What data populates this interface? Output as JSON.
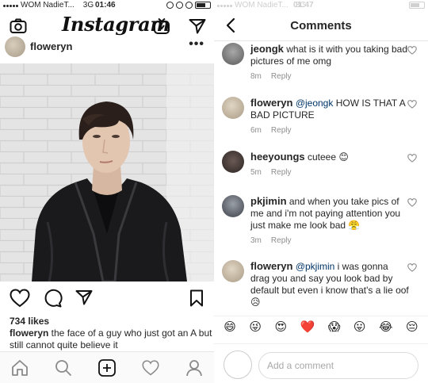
{
  "left_status": {
    "carrier": "WOM NadieT...",
    "network": "3G",
    "time": "01:46"
  },
  "right_status": {
    "carrier": "WOM NadieT...",
    "network": "3G",
    "time": "01:47"
  },
  "feed": {
    "logo": "Instagram",
    "post": {
      "username": "floweryn",
      "more": "•••",
      "watermark": "",
      "likes": "734 likes",
      "caption_user": "floweryn",
      "caption_text": " the face of a guy who just got an A but still cannot quite believe it"
    },
    "icons": {
      "camera": "camera-icon",
      "igtv": "igtv-icon",
      "direct": "direct-message-icon",
      "like": "heart-icon",
      "comment": "comment-icon",
      "share": "share-icon",
      "save": "bookmark-icon",
      "home": "home-icon",
      "search": "search-icon",
      "add": "add-post-icon",
      "activity": "activity-heart-icon",
      "profile": "profile-icon"
    }
  },
  "comments_screen": {
    "title": "Comments",
    "comments": [
      {
        "user": "jeongk",
        "mention": "",
        "text": " what is it with you taking bad pictures of me omg",
        "time": "8m",
        "reply": "Reply"
      },
      {
        "user": "floweryn",
        "mention": "@jeongk",
        "text": " HOW IS THAT A BAD PICTURE",
        "time": "6m",
        "reply": "Reply"
      },
      {
        "user": "heeyoungs",
        "mention": "",
        "text": " cuteee 😊",
        "time": "5m",
        "reply": "Reply"
      },
      {
        "user": "pkjimin",
        "mention": "",
        "text": " and when you take pics of me and i'm not paying attention you just make me look bad 😤",
        "time": "3m",
        "reply": "Reply"
      },
      {
        "user": "floweryn",
        "mention": "@pkjimin",
        "text": " i was gonna drag you and say you look bad by default but even i know that's a lie oof 😥",
        "time": "",
        "reply": ""
      }
    ],
    "emojis": [
      "😄",
      "😜",
      "😍",
      "❤️",
      "😱",
      "😛",
      "😂",
      "😔"
    ],
    "input_placeholder": "Add a comment"
  },
  "colors": {
    "mention": "#003569",
    "meta": "#8e8e8e",
    "heart_red": "#ed4956"
  }
}
